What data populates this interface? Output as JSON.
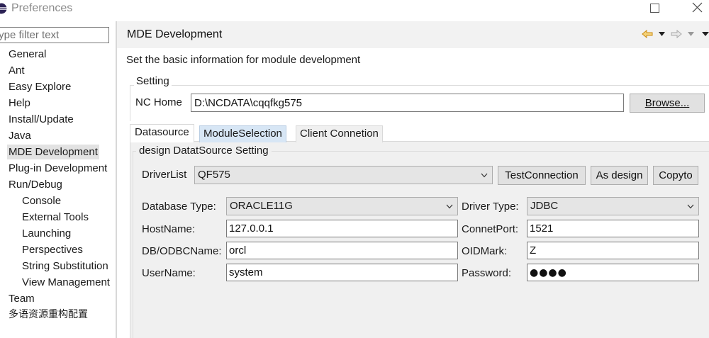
{
  "window": {
    "title": "Preferences"
  },
  "filter": {
    "placeholder": "type filter text"
  },
  "tree": {
    "items": [
      {
        "label": "General"
      },
      {
        "label": "Ant"
      },
      {
        "label": "Easy Explore"
      },
      {
        "label": "Help"
      },
      {
        "label": "Install/Update"
      },
      {
        "label": "Java"
      },
      {
        "label": "MDE Development"
      },
      {
        "label": "Plug-in Development"
      },
      {
        "label": "Run/Debug"
      },
      {
        "label": "Console"
      },
      {
        "label": "External Tools"
      },
      {
        "label": "Launching"
      },
      {
        "label": "Perspectives"
      },
      {
        "label": "String Substitution"
      },
      {
        "label": "View Management"
      },
      {
        "label": "Team"
      },
      {
        "label": "多语资源重构配置"
      }
    ],
    "selected": "MDE Development"
  },
  "page": {
    "title": "MDE Development",
    "description": "Set the basic information for module development"
  },
  "setting": {
    "group_label": "Setting",
    "nchome_label": "NC Home",
    "nchome_value": "D:\\NCDATA\\cqqfkg575",
    "browse_label": "Browse..."
  },
  "tabs": [
    {
      "label": "Datasource",
      "active": true
    },
    {
      "label": "ModuleSelection",
      "active": false
    },
    {
      "label": "Client Connetion",
      "active": false
    }
  ],
  "datasource": {
    "group_label": "design DatatSource Setting",
    "driverlist_label": "DriverList",
    "driverlist_value": "QF575",
    "test_connection_label": "TestConnection",
    "as_design_label": "As design",
    "copyto_label": "Copyto",
    "database_type_label": "Database Type:",
    "database_type_value": "ORACLE11G",
    "driver_type_label": "Driver Type:",
    "driver_type_value": "JDBC",
    "hostname_label": "HostName:",
    "hostname_value": "127.0.0.1",
    "connetport_label": "ConnetPort:",
    "connetport_value": "1521",
    "dbodbcname_label": "DB/ODBCName:",
    "dbodbcname_value": "orcl",
    "oidmark_label": "OIDMark:",
    "oidmark_value": "Z",
    "username_label": "UserName:",
    "username_value": "system",
    "password_label": "Password:",
    "password_value": "●●●●"
  },
  "colors": {
    "selected_item": "#e2e2e2",
    "tab_highlight": "#d7e6f5",
    "panel_bg": "#f0f0f0",
    "nav_arrow": "#e5a021"
  },
  "icons": {
    "app": "eclipse-icon",
    "maximize": "maximize-icon",
    "close": "close-icon",
    "back": "back-arrow-icon",
    "forward": "forward-arrow-icon",
    "dropdown": "chevron-down-icon"
  }
}
